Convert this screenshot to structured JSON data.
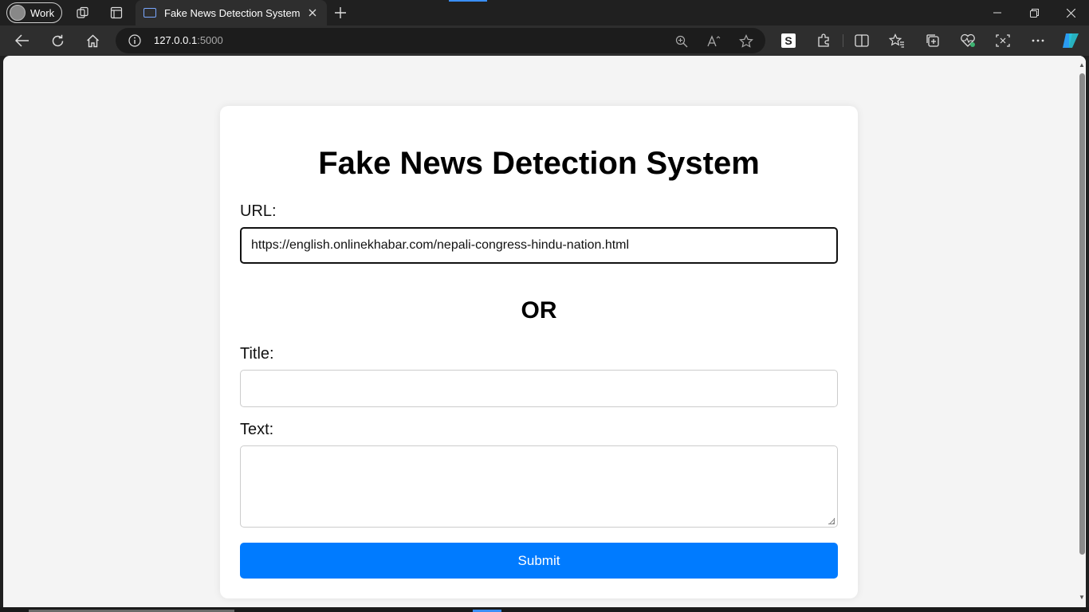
{
  "browser": {
    "profile_label": "Work",
    "tab_title": "Fake News Detection System",
    "address_host": "127.0.0.1",
    "address_port": ":5000"
  },
  "page": {
    "heading": "Fake News Detection System",
    "url_label": "URL:",
    "url_value": "https://english.onlinekhabar.com/nepali-congress-hindu-nation.html",
    "or_text": "OR",
    "title_label": "Title:",
    "title_value": "",
    "text_label": "Text:",
    "text_value": "",
    "submit_label": "Submit"
  },
  "colors": {
    "submit_bg": "#007bff",
    "page_bg": "#f4f4f4",
    "card_bg": "#ffffff"
  }
}
